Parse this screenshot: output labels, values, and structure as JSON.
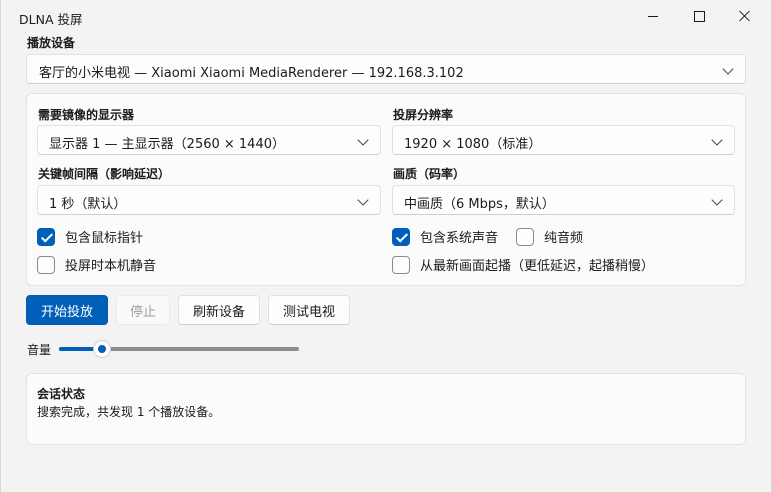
{
  "window": {
    "title": "DLNA 投屏"
  },
  "device": {
    "label": "播放设备",
    "selected": "客厅的小米电视 — Xiaomi Xiaomi MediaRenderer — 192.168.3.102"
  },
  "settings": {
    "display_label": "需要镜像的显示器",
    "display_value": "显示器 1 — 主显示器（2560 × 1440）",
    "resolution_label": "投屏分辨率",
    "resolution_value": "1920 × 1080（标准）",
    "keyframe_label": "关键帧间隔（影响延迟）",
    "keyframe_value": "1 秒（默认）",
    "quality_label": "画质（码率）",
    "quality_value": "中画质（6 Mbps，默认）"
  },
  "options": {
    "include_cursor": {
      "label": "包含鼠标指针",
      "checked": true
    },
    "mute_local": {
      "label": "投屏时本机静音",
      "checked": false
    },
    "include_system_audio": {
      "label": "包含系统声音",
      "checked": true
    },
    "audio_only": {
      "label": "纯音频",
      "checked": false
    },
    "from_latest_frame": {
      "label": "从最新画面起播（更低延迟，起播稍慢）",
      "checked": false
    }
  },
  "actions": {
    "start": "开始投放",
    "stop": "停止",
    "refresh": "刷新设备",
    "test_tv": "测试电视"
  },
  "volume": {
    "label": "音量",
    "value": 0.18
  },
  "status": {
    "title": "会话状态",
    "message": "搜索完成，共发现 1 个播放设备。"
  },
  "colors": {
    "accent": "#005fb8"
  }
}
